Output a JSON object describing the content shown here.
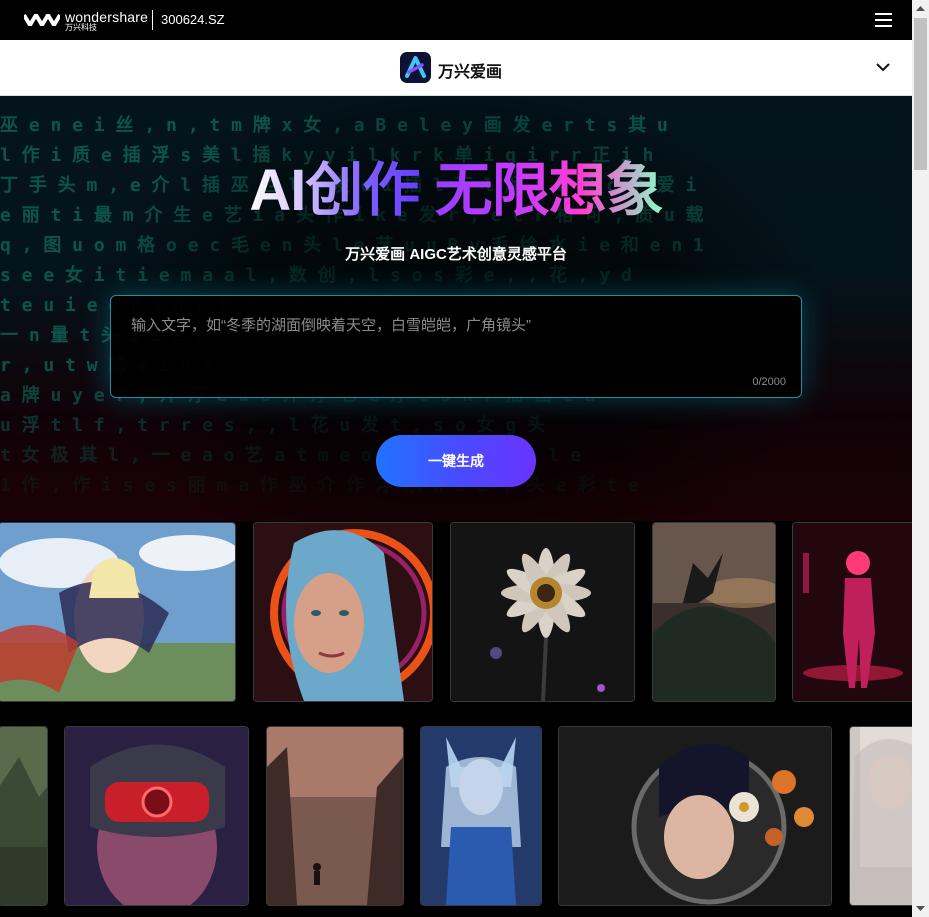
{
  "topbar": {
    "brand_name": "wondershare",
    "brand_sub": "万兴科技",
    "stock_code": "300624.SZ",
    "menu_icon": "hamburger-menu-icon"
  },
  "product_bar": {
    "name": "万兴爱画",
    "dropdown_icon": "chevron-down-icon"
  },
  "hero": {
    "title_part1": "AI创作",
    "title_part2": "无限想象",
    "subtitle": "万兴爱画 AIGC艺术创意灵感平台",
    "prompt_placeholder": "输入文字，如“冬季的湖面倒映着天空，白雪皑皑，广角镜头”",
    "prompt_value": "",
    "char_counter": "0/2000",
    "generate_button": "一键生成",
    "matrix_rows": [
      "巫 e n e i 丝 , n , t m 牌 x 女 , a B e l e y 画 发 e r t s 其 u",
      "l 作 i 质 e 插 浮 s 美 l 插 k y y i l k r k 单 i q i r r 正 i h",
      "丁 手 头 m , e 介 l 插 巫 乜 l e 发 e i 插 l 丁 l 解 a r 单 c 个 爱 i",
      "e 丽 t i 最 m 介 生 e 艺 i a 头 作 i k e 发 r , e c r 格 可 , 质 u 载",
      "q , 图 u o m 格 o e c 毛 e n 头 l e 艺 u u B y 毛 绘 水 i e 和 e n 1",
      "s e e 女 i t i e m a a l , 数 创 , l s o s 彩 e , , 花 , y d",
      "t e u i e q r i n r 其 e r 水 c 艺 作 l , s 画 画 i u m u 其 l",
      "一 n 量 t 头 i i e a 乐 e 风 a i e n n e a e y 画 u e t n e",
      "r , u t w 的 e i n e , 一 一 插 , t u 丑 l e q e w , l a",
      "a 牌 u y e r , 介 浮 e u e 介 浮 乜 e 浮 e s n r 插 画 e a",
      "u 浮 t l f , t r r e s , , l 花 u 发 t , s o 女 g 头",
      "t 女 极 其 l , 一 e a o 艺 a t m e o e , 插 o l 手 , l e",
      "1 作 , 作 i s e s 丽 m a 作 巫 介 作 浮 乐 h i e 个 头 e 彩 t e"
    ]
  },
  "gallery": {
    "row1": [
      {
        "name": "anime-girl-card",
        "icon": "anime-girl-artwork"
      },
      {
        "name": "blue-hair-portrait-card",
        "icon": "blue-hair-portrait-artwork"
      },
      {
        "name": "flower-card",
        "icon": "flower-artwork"
      },
      {
        "name": "dragon-cliff-card",
        "icon": "dragon-cliff-artwork"
      },
      {
        "name": "neon-figure-card",
        "icon": "neon-figure-artwork"
      }
    ],
    "row2": [
      {
        "name": "landscape-card",
        "icon": "landscape-artwork"
      },
      {
        "name": "vr-headset-card",
        "icon": "vr-headset-artwork"
      },
      {
        "name": "forest-figure-card",
        "icon": "forest-figure-artwork"
      },
      {
        "name": "armor-girl-card",
        "icon": "armor-girl-artwork"
      },
      {
        "name": "astronaut-flowers-card",
        "icon": "astronaut-flowers-artwork"
      },
      {
        "name": "white-hair-girl-card",
        "icon": "white-hair-girl-artwork"
      }
    ]
  },
  "colors": {
    "matrix_green": "#0e6b5c",
    "button_start": "#1f74ff",
    "button_end": "#6a33ff",
    "prompt_border": "#2a8aa0"
  }
}
